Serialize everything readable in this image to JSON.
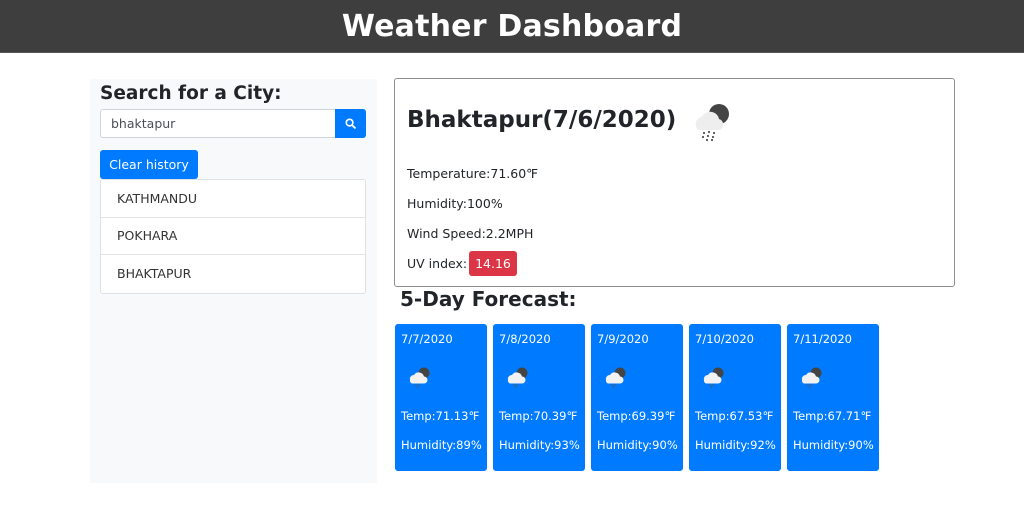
{
  "header": {
    "title": "Weather Dashboard"
  },
  "sidebar": {
    "heading": "Search for a City:",
    "search_value": "bhaktapur",
    "search_icon": "search-icon",
    "clear_label": "Clear history",
    "history": [
      {
        "label": "KATHMANDU"
      },
      {
        "label": "POKHARA"
      },
      {
        "label": "BHAKTAPUR"
      }
    ]
  },
  "current": {
    "title": "Bhaktapur(7/6/2020)",
    "icon": "rain-cloud-moon-icon",
    "temperature": "Temperature:71.60℉",
    "humidity": "Humidity:100%",
    "wind": "Wind Speed:2.2MPH",
    "uv_label": "UV index:",
    "uv_value": "14.16",
    "uv_color": "#dc3545"
  },
  "forecast": {
    "title": "5-Day Forecast:",
    "accent": "#007bff",
    "days": [
      {
        "date": "7/7/2020",
        "icon": "rain-cloud-moon-icon",
        "temp": "Temp:71.13℉",
        "humidity": "Humidity:89%"
      },
      {
        "date": "7/8/2020",
        "icon": "rain-cloud-moon-icon",
        "temp": "Temp:70.39℉",
        "humidity": "Humidity:93%"
      },
      {
        "date": "7/9/2020",
        "icon": "rain-cloud-moon-icon",
        "temp": "Temp:69.39℉",
        "humidity": "Humidity:90%"
      },
      {
        "date": "7/10/2020",
        "icon": "rain-cloud-moon-icon",
        "temp": "Temp:67.53℉",
        "humidity": "Humidity:92%"
      },
      {
        "date": "7/11/2020",
        "icon": "rain-cloud-moon-icon",
        "temp": "Temp:67.71℉",
        "humidity": "Humidity:90%"
      }
    ]
  }
}
